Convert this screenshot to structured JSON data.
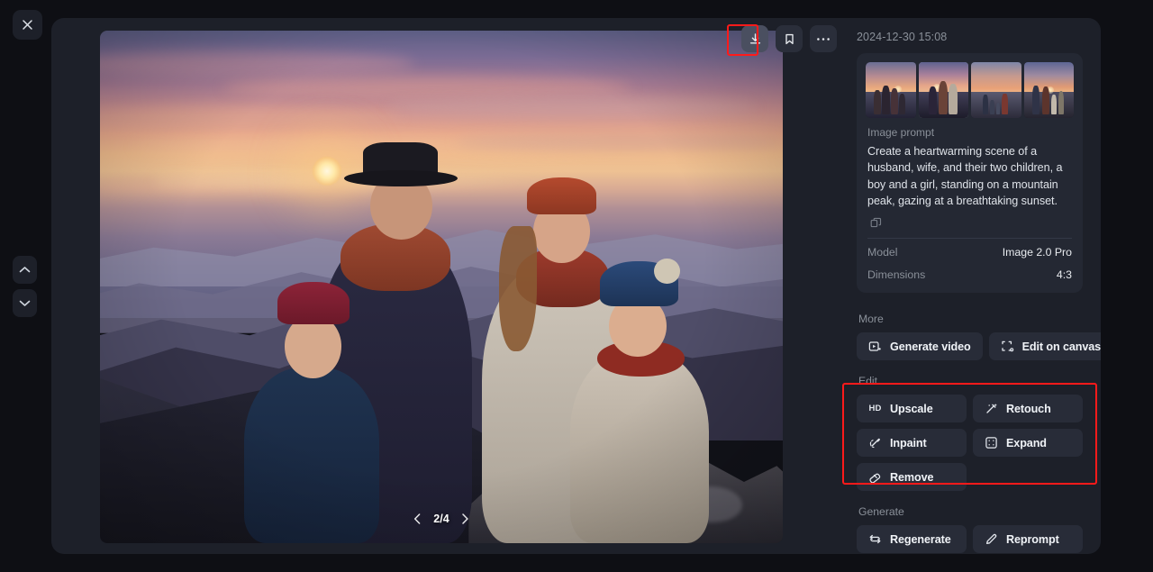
{
  "window": {
    "close_label": "Close",
    "nav_up_label": "Previous image",
    "nav_down_label": "Next image"
  },
  "toolbar": {
    "download_label": "Download",
    "bookmark_label": "Bookmark",
    "more_label": "More options"
  },
  "viewer": {
    "page_current": 2,
    "page_total": 4,
    "page_indicator": "2/4",
    "prev_label": "Previous",
    "next_label": "Next"
  },
  "sidebar": {
    "timestamp": "2024-12-30 15:08",
    "thumbnails": [
      {
        "index": 1,
        "selected": false
      },
      {
        "index": 2,
        "selected": true
      },
      {
        "index": 3,
        "selected": false
      },
      {
        "index": 4,
        "selected": false
      }
    ],
    "prompt_label": "Image prompt",
    "prompt_text": "Create a heartwarming scene of a husband, wife, and their two children, a boy and a girl, standing on a mountain peak, gazing at a breathtaking sunset.",
    "copy_label": "Copy prompt",
    "meta": [
      {
        "key": "Model",
        "value": "Image 2.0 Pro"
      },
      {
        "key": "Dimensions",
        "value": "4:3"
      }
    ],
    "sections": [
      {
        "label": "More",
        "buttons": [
          {
            "label": "Generate video",
            "icon": "video-frame-icon"
          },
          {
            "label": "Edit on canvas",
            "icon": "canvas-crop-icon"
          }
        ]
      },
      {
        "label": "Edit",
        "highlighted": true,
        "buttons": [
          {
            "label": "Upscale",
            "icon": "hd-icon"
          },
          {
            "label": "Retouch",
            "icon": "magic-wand-icon"
          },
          {
            "label": "Inpaint",
            "icon": "paint-brush-icon"
          },
          {
            "label": "Expand",
            "icon": "expand-frame-icon"
          },
          {
            "label": "Remove",
            "icon": "eraser-icon"
          }
        ]
      },
      {
        "label": "Generate",
        "buttons": [
          {
            "label": "Regenerate",
            "icon": "refresh-loop-icon"
          },
          {
            "label": "Reprompt",
            "icon": "pencil-icon"
          }
        ]
      }
    ]
  },
  "colors": {
    "page_background": "#0e0f14",
    "panel_background": "#1d2029",
    "card_background": "#242833",
    "button_background": "#282c38",
    "text_primary": "#f0f3f7",
    "text_muted": "#8a9099",
    "annotation": "#ff1a1a"
  }
}
